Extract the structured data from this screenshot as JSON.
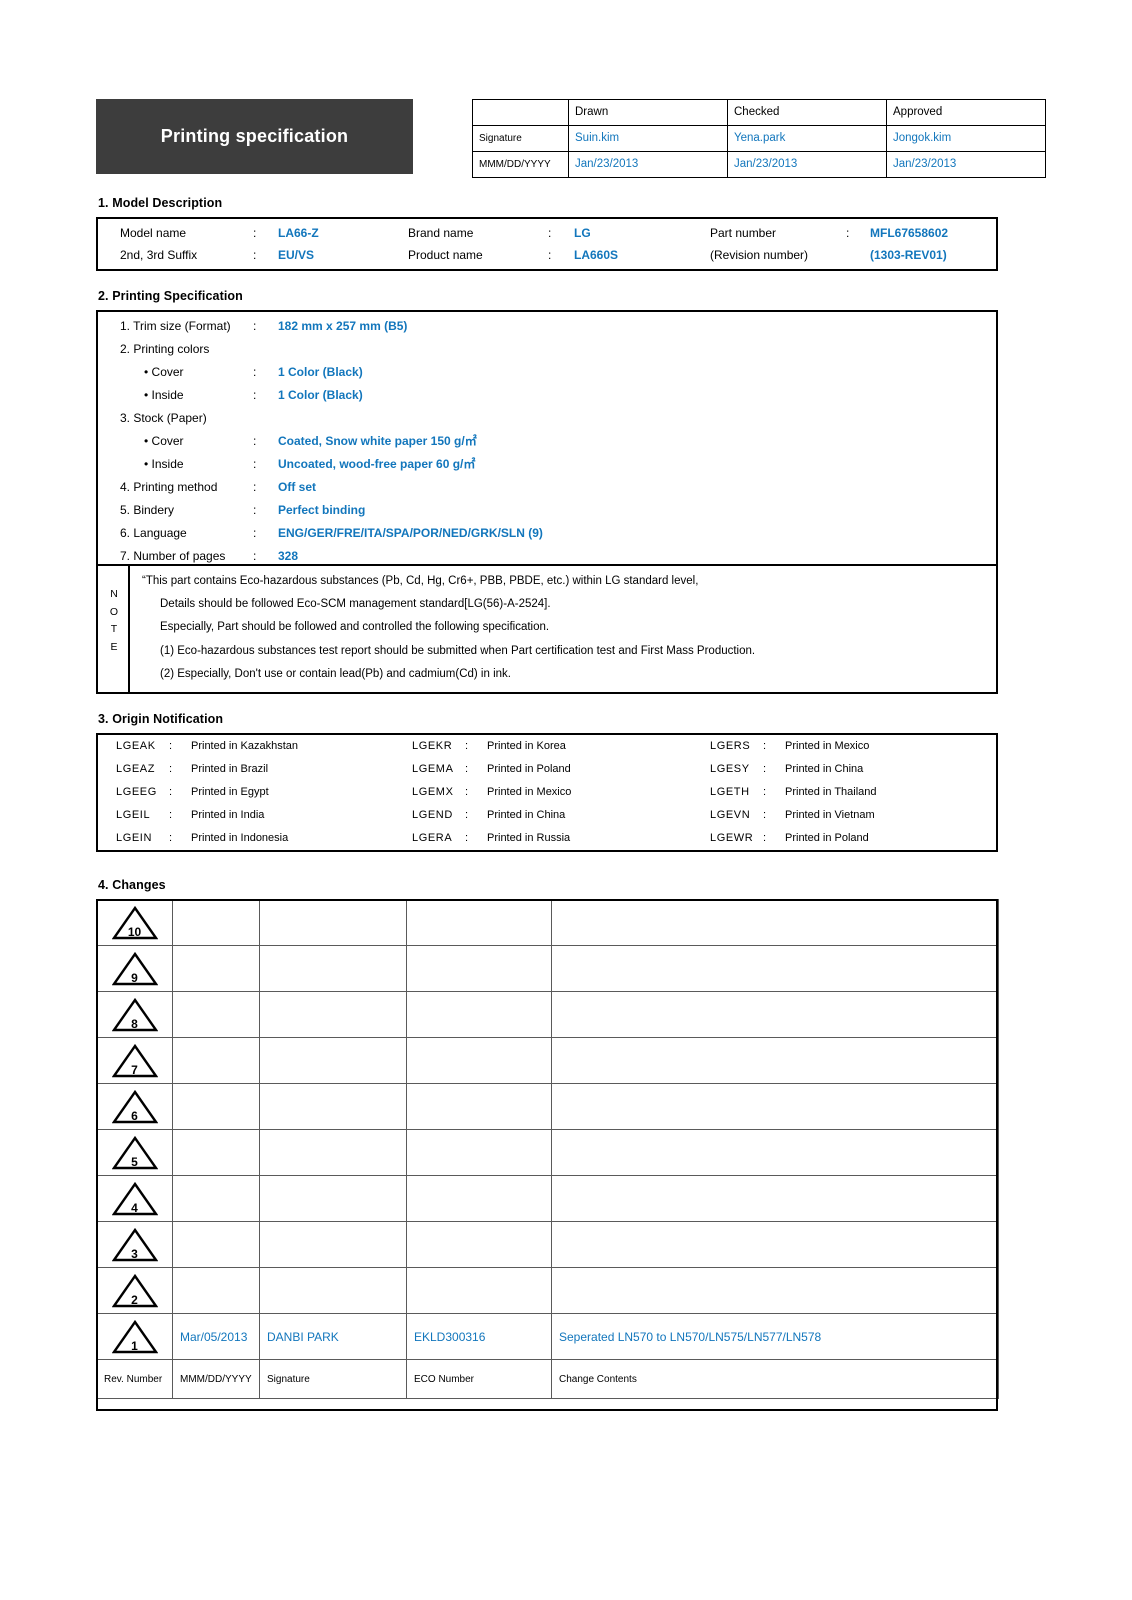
{
  "document": {
    "title": "Printing specification"
  },
  "approval": {
    "columns": [
      "Drawn",
      "Checked",
      "Approved"
    ],
    "row_labels": {
      "signature": "Signature",
      "date": "MMM/DD/YYYY"
    },
    "signatures": [
      "Suin.kim",
      "Yena.park",
      "Jongok.kim"
    ],
    "dates": [
      "Jan/23/2013",
      "Jan/23/2013",
      "Jan/23/2013"
    ]
  },
  "sections": {
    "model_description": "1. Model Description",
    "printing_specification": "2. Printing Specification",
    "origin_notification": "3. Origin Notification",
    "changes": "4. Changes"
  },
  "model_description": {
    "colon": ":",
    "row1": [
      {
        "label": "Model name",
        "colon": ":",
        "value": "LA66-Z"
      },
      {
        "label": "Brand name",
        "colon": ":",
        "value": "LG"
      },
      {
        "label": "Part number",
        "colon": ":",
        "value": "MFL67658602"
      }
    ],
    "row2": [
      {
        "label": "2nd, 3rd Suffix",
        "colon": ":",
        "value": "EU/VS"
      },
      {
        "label": "Product name",
        "colon": ":",
        "value": "LA660S"
      },
      {
        "label": "(Revision number)",
        "colon": "",
        "value": "(1303-REV01)"
      }
    ]
  },
  "printing_specification": {
    "colon": ":",
    "items": [
      {
        "label": "1. Trim size (Format)",
        "colon": ":",
        "value": "182 mm x 257 mm (B5)",
        "indent": false
      },
      {
        "label": "2. Printing colors",
        "colon": "",
        "value": "",
        "indent": false
      },
      {
        "label": "• Cover",
        "colon": ":",
        "value": "1 Color (Black)",
        "indent": true
      },
      {
        "label": "• Inside",
        "colon": ":",
        "value": "1 Color (Black)",
        "indent": true
      },
      {
        "label": "3. Stock (Paper)",
        "colon": "",
        "value": "",
        "indent": false
      },
      {
        "label": "• Cover",
        "colon": ":",
        "value": "Coated, Snow white paper 150 g/㎡",
        "indent": true
      },
      {
        "label": "• Inside",
        "colon": ":",
        "value": "Uncoated, wood-free paper 60 g/㎡",
        "indent": true
      },
      {
        "label": "4. Printing method",
        "colon": ":",
        "value": "Off set",
        "indent": false
      },
      {
        "label": "5. Bindery",
        "colon": ":",
        "value": "Perfect binding",
        "indent": false
      },
      {
        "label": "6. Language",
        "colon": ":",
        "value": "ENG/GER/FRE/ITA/SPA/POR/NED/GRK/SLN (9)",
        "indent": false
      },
      {
        "label": "7. Number of pages",
        "colon": ":",
        "value": "328",
        "indent": false
      }
    ]
  },
  "note": {
    "side_label": "N O T E",
    "lines": [
      "“This part contains Eco-hazardous substances (Pb, Cd, Hg, Cr6+, PBB, PBDE, etc.) within LG standard level,",
      "Details should be followed Eco-SCM management standard[LG(56)-A-2524].",
      "Especially, Part should be followed and controlled the following specification.",
      "(1) Eco-hazardous substances test report should be submitted when Part certification test and First Mass Production.",
      "(2) Especially, Don't use or contain lead(Pb) and cadmium(Cd) in ink."
    ]
  },
  "origin_notification": {
    "colon": ":",
    "entries": [
      {
        "code": "LGEAK",
        "colon": ":",
        "name": "Printed in Kazakhstan"
      },
      {
        "code": "LGEKR",
        "colon": ":",
        "name": "Printed in Korea"
      },
      {
        "code": "LGERS",
        "colon": ":",
        "name": "Printed in Mexico"
      },
      {
        "code": "LGEAZ",
        "colon": ":",
        "name": "Printed in Brazil"
      },
      {
        "code": "LGEMA",
        "colon": ":",
        "name": "Printed in Poland"
      },
      {
        "code": "LGESY",
        "colon": ":",
        "name": "Printed in China"
      },
      {
        "code": "LGEEG",
        "colon": ":",
        "name": "Printed in Egypt"
      },
      {
        "code": "LGEMX",
        "colon": ":",
        "name": "Printed in Mexico"
      },
      {
        "code": "LGETH",
        "colon": ":",
        "name": "Printed in Thailand"
      },
      {
        "code": "LGEIL",
        "colon": ":",
        "name": "Printed in India"
      },
      {
        "code": "LGEND",
        "colon": ":",
        "name": "Printed in China"
      },
      {
        "code": "LGEVN",
        "colon": ":",
        "name": "Printed in Vietnam"
      },
      {
        "code": "LGEIN",
        "colon": ":",
        "name": "Printed in Indonesia"
      },
      {
        "code": "LGERA",
        "colon": ":",
        "name": "Printed in Russia"
      },
      {
        "code": "LGEWR",
        "colon": ":",
        "name": "Printed in Poland"
      }
    ]
  },
  "changes": {
    "legend": {
      "rev": "Rev. Number",
      "date": "MMM/DD/YYYY",
      "signature": "Signature",
      "eco": "ECO Number",
      "contents": "Change Contents"
    },
    "rows": [
      {
        "rev": "10",
        "date": "",
        "signature": "",
        "eco": "",
        "contents": ""
      },
      {
        "rev": "9",
        "date": "",
        "signature": "",
        "eco": "",
        "contents": ""
      },
      {
        "rev": "8",
        "date": "",
        "signature": "",
        "eco": "",
        "contents": ""
      },
      {
        "rev": "7",
        "date": "",
        "signature": "",
        "eco": "",
        "contents": ""
      },
      {
        "rev": "6",
        "date": "",
        "signature": "",
        "eco": "",
        "contents": ""
      },
      {
        "rev": "5",
        "date": "",
        "signature": "",
        "eco": "",
        "contents": ""
      },
      {
        "rev": "4",
        "date": "",
        "signature": "",
        "eco": "",
        "contents": ""
      },
      {
        "rev": "3",
        "date": "",
        "signature": "",
        "eco": "",
        "contents": ""
      },
      {
        "rev": "2",
        "date": "",
        "signature": "",
        "eco": "",
        "contents": ""
      },
      {
        "rev": "1",
        "date": "Mar/05/2013",
        "signature": "DANBI PARK",
        "eco": "EKLD300316",
        "contents": "Seperated LN570 to LN570/LN575/LN577/LN578"
      }
    ]
  },
  "colors": {
    "accent_blue": "#1276bc",
    "banner_dark": "#3d3d3d",
    "border_black": "#000000",
    "grid_gray": "#5a5a5a"
  }
}
